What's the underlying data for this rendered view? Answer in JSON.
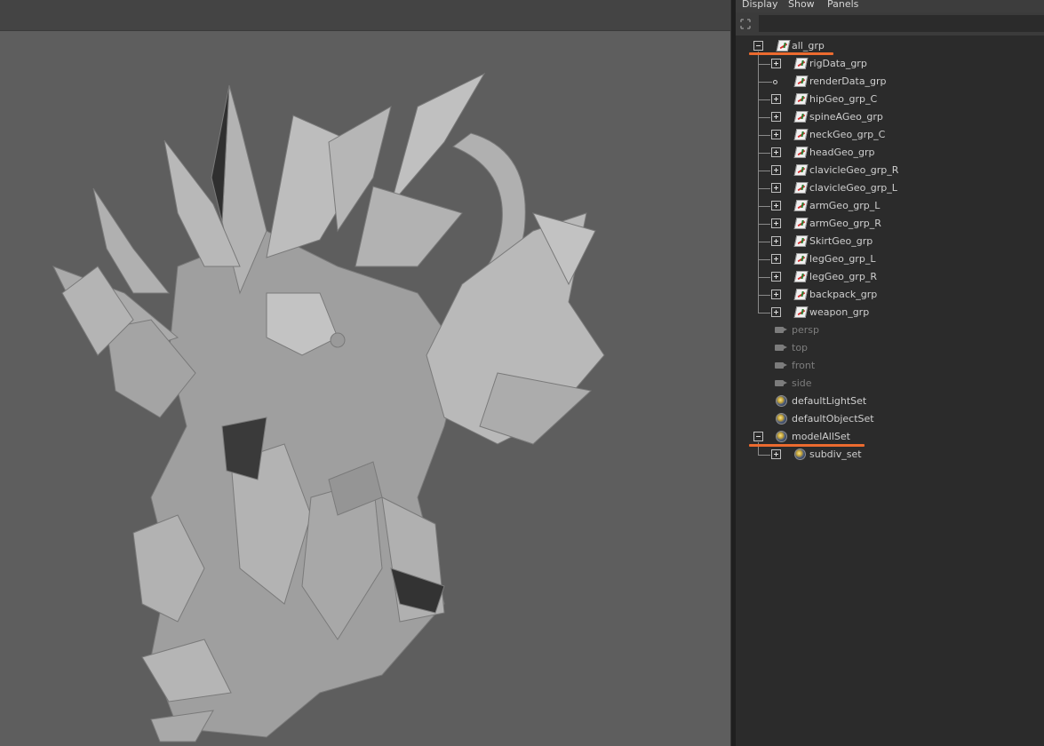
{
  "outliner": {
    "menu": [
      "Display",
      "Show",
      "Panels"
    ],
    "search": {
      "placeholder": "",
      "value": ""
    },
    "items": [
      {
        "label": "all_grp"
      },
      {
        "label": "rigData_grp"
      },
      {
        "label": "renderData_grp"
      },
      {
        "label": "hipGeo_grp_C"
      },
      {
        "label": "spineAGeo_grp"
      },
      {
        "label": "neckGeo_grp_C"
      },
      {
        "label": "headGeo_grp"
      },
      {
        "label": "clavicleGeo_grp_R"
      },
      {
        "label": "clavicleGeo_grp_L"
      },
      {
        "label": "armGeo_grp_L"
      },
      {
        "label": "armGeo_grp_R"
      },
      {
        "label": "SkirtGeo_grp"
      },
      {
        "label": "legGeo_grp_L"
      },
      {
        "label": "legGeo_grp_R"
      },
      {
        "label": "backpack_grp"
      },
      {
        "label": "weapon_grp"
      },
      {
        "label": "persp"
      },
      {
        "label": "top"
      },
      {
        "label": "front"
      },
      {
        "label": "side"
      },
      {
        "label": "defaultLightSet"
      },
      {
        "label": "defaultObjectSet"
      },
      {
        "label": "modelAllSet"
      },
      {
        "label": "subdiv_set"
      }
    ]
  },
  "colors": {
    "viewport_bg": "#5e5e5e",
    "outliner_bg": "#2b2b2b",
    "annotation": "#ec6b2f",
    "camera_text": "#7d7d7d",
    "item_text": "#cfcfcf"
  }
}
